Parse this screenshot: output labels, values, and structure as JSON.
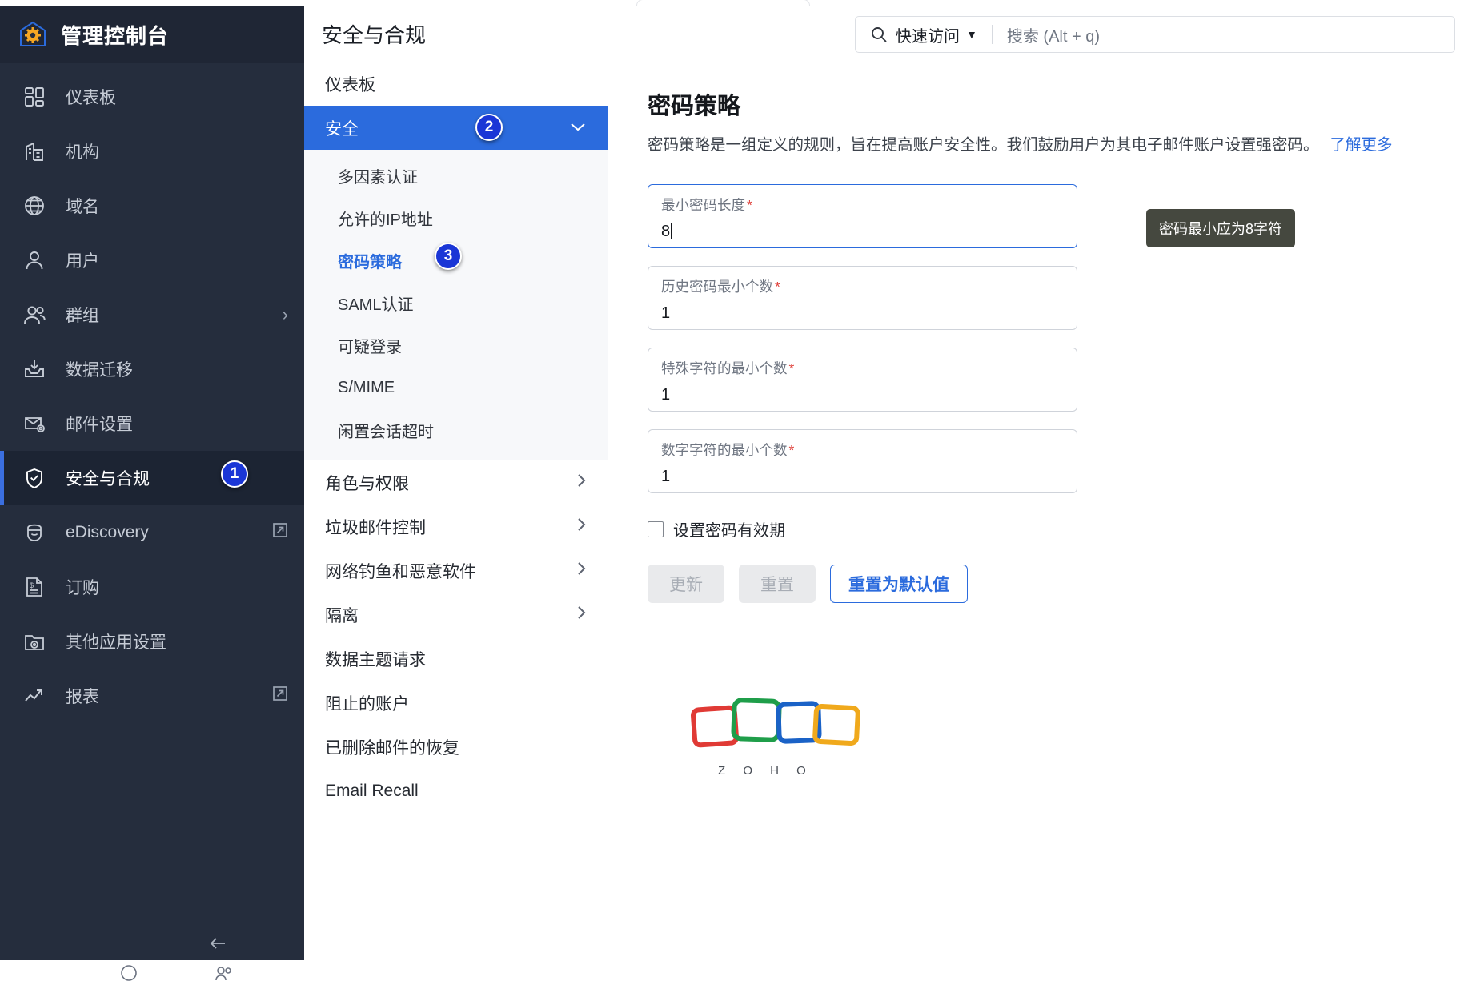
{
  "brand": {
    "title": "管理控制台",
    "logo_icon": "home-gear-icon"
  },
  "sidebar": {
    "items": [
      {
        "label": "仪表板",
        "icon": "dashboard-icon",
        "chevron": false,
        "external": false
      },
      {
        "label": "机构",
        "icon": "organization-icon",
        "chevron": false,
        "external": false
      },
      {
        "label": "域名",
        "icon": "globe-icon",
        "chevron": false,
        "external": false
      },
      {
        "label": "用户",
        "icon": "user-icon",
        "chevron": false,
        "external": false
      },
      {
        "label": "群组",
        "icon": "group-icon",
        "chevron": true,
        "external": false
      },
      {
        "label": "数据迁移",
        "icon": "data-migration-icon",
        "chevron": false,
        "external": false
      },
      {
        "label": "邮件设置",
        "icon": "mail-settings-icon",
        "chevron": false,
        "external": false
      },
      {
        "label": "安全与合规",
        "icon": "shield-check-icon",
        "chevron": false,
        "external": false,
        "active": true
      },
      {
        "label": "eDiscovery",
        "icon": "ediscovery-icon",
        "chevron": false,
        "external": true
      },
      {
        "label": "订购",
        "icon": "subscription-icon",
        "chevron": false,
        "external": false
      },
      {
        "label": "其他应用设置",
        "icon": "apps-settings-icon",
        "chevron": false,
        "external": false
      },
      {
        "label": "报表",
        "icon": "reports-icon",
        "chevron": false,
        "external": true
      }
    ],
    "collapse_icon": "collapse-left-icon"
  },
  "submenu": {
    "top_item": "仪表板",
    "group": {
      "label": "安全",
      "expanded": true,
      "children": [
        "多因素认证",
        "允许的IP地址",
        "密码策略",
        "SAML认证",
        "可疑登录",
        "S/MIME",
        "闲置会话超时"
      ],
      "current_child": "密码策略"
    },
    "rows": [
      {
        "label": "角色与权限",
        "chevron": true
      },
      {
        "label": "垃圾邮件控制",
        "chevron": true
      },
      {
        "label": "网络钓鱼和恶意软件",
        "chevron": true
      },
      {
        "label": "隔离",
        "chevron": true
      },
      {
        "label": "数据主题请求",
        "chevron": false
      },
      {
        "label": "阻止的账户",
        "chevron": false
      },
      {
        "label": "已删除邮件的恢复",
        "chevron": false
      },
      {
        "label": "Email Recall",
        "chevron": false
      }
    ]
  },
  "header": {
    "title": "安全与合规",
    "search": {
      "icon": "search-icon",
      "quick_access_label": "快速访问",
      "caret": "▼",
      "placeholder": "搜索 (Alt + q)"
    }
  },
  "content": {
    "title": "密码策略",
    "description": "密码策略是一组定义的规则，旨在提高账户安全性。我们鼓励用户为其电子邮件账户设置强密码。",
    "learn_more": "了解更多",
    "fields": [
      {
        "label": "最小密码长度",
        "required": "*",
        "value": "8",
        "focused": true
      },
      {
        "label": "历史密码最小个数",
        "required": "*",
        "value": "1",
        "focused": false
      },
      {
        "label": "特殊字符的最小个数",
        "required": "*",
        "value": "1",
        "focused": false
      },
      {
        "label": "数字字符的最小个数",
        "required": "*",
        "value": "1",
        "focused": false
      }
    ],
    "tooltip": "密码最小应为8字符",
    "checkbox": {
      "label": "设置密码有效期",
      "checked": false
    },
    "buttons": [
      {
        "label": "更新",
        "style": "disabled"
      },
      {
        "label": "重置",
        "style": "disabled"
      },
      {
        "label": "重置为默认值",
        "style": "outline"
      }
    ],
    "zoho_wordmark": "Z O H O"
  },
  "callouts": [
    {
      "number": "1",
      "target": "sidebar-item-security-compliance"
    },
    {
      "number": "2",
      "target": "submenu-group-security"
    },
    {
      "number": "3",
      "target": "submenu-child-password-policy"
    }
  ],
  "colors": {
    "accent": "#2b6bdd",
    "sidebar_bg": "#252d3d",
    "badge": "#1a36d6",
    "tooltip_bg": "#45483f",
    "required": "#e0443e"
  }
}
